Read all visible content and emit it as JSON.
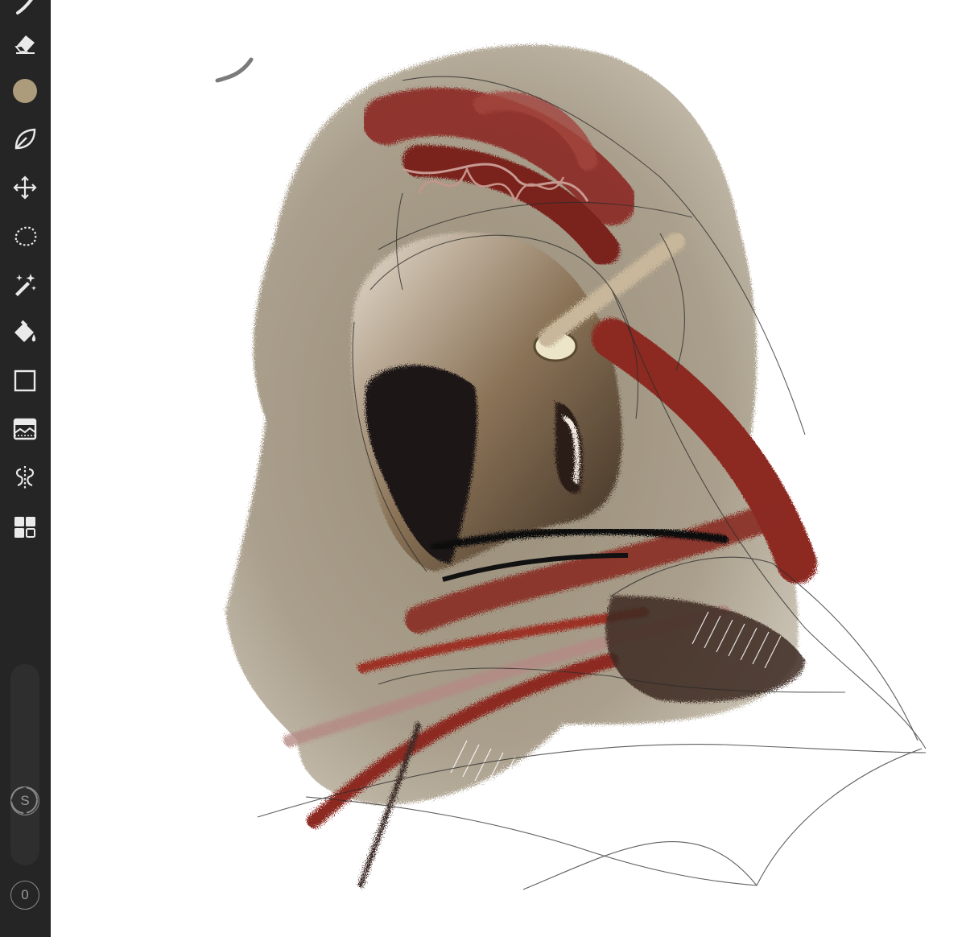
{
  "app": "Drawing app",
  "toolbar": {
    "color_swatch": "#ad9c7c",
    "tools": [
      {
        "name": "eraser",
        "icon": "eraser-icon"
      },
      {
        "name": "color",
        "icon": "color-swatch"
      },
      {
        "name": "smudge",
        "icon": "leaf-smudge-icon"
      },
      {
        "name": "transform",
        "icon": "move-arrows-icon"
      },
      {
        "name": "lasso-selection",
        "icon": "lasso-icon"
      },
      {
        "name": "magic-wand",
        "icon": "magic-wand-icon"
      },
      {
        "name": "fill",
        "icon": "paint-bucket-icon"
      },
      {
        "name": "shape",
        "icon": "square-icon"
      },
      {
        "name": "image",
        "icon": "image-icon"
      },
      {
        "name": "symmetry",
        "icon": "symmetry-icon"
      },
      {
        "name": "layers",
        "icon": "grid-icon"
      }
    ],
    "stabilizer_label": "S",
    "opacity_label": "0"
  },
  "colors": {
    "sidebar": "#252525",
    "canvas": "#ffffff",
    "beige": "#a79d8a",
    "red": "#8c2a22",
    "dark": "#1e1816"
  }
}
